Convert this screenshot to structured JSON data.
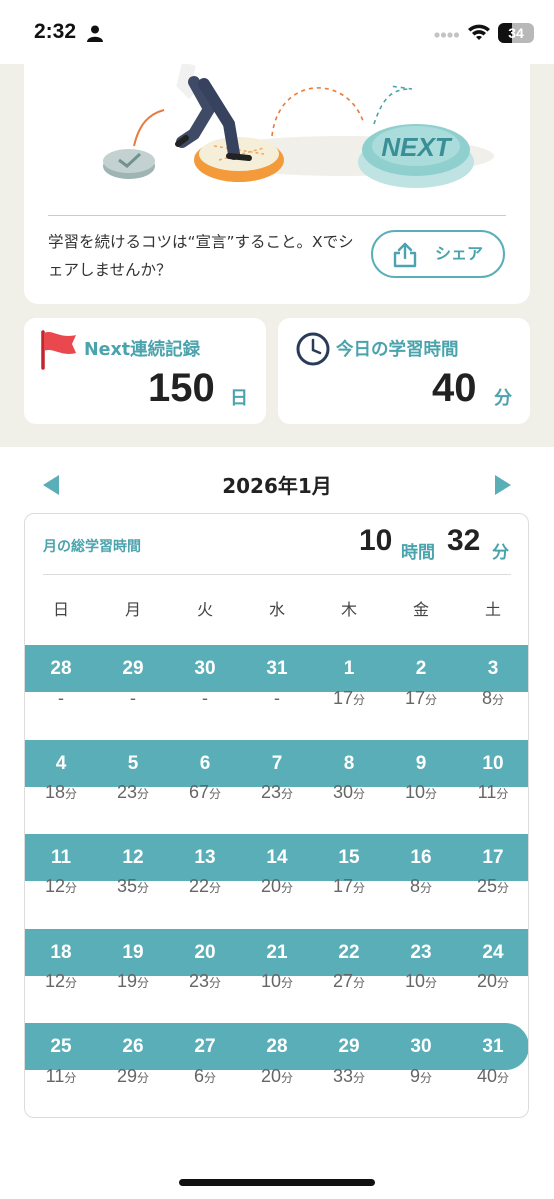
{
  "status_bar": {
    "time": "2:32",
    "battery": "34"
  },
  "share": {
    "text": "学習を続けるコツは“宣言”すること。Xでシェアしませんか？",
    "button_label": "シェア",
    "illustration_label": "NEXT"
  },
  "streak": {
    "title": "Next連続記録",
    "value": "150",
    "unit": "日"
  },
  "today": {
    "title": "今日の学習時間",
    "value": "40",
    "unit": "分"
  },
  "calendar": {
    "month_title": "2026年1月",
    "total_label": "月の総学習時間",
    "total_hours": "10",
    "hours_unit": "時間",
    "total_minutes": "32",
    "minutes_unit": "分",
    "weekdays": [
      "日",
      "月",
      "火",
      "水",
      "木",
      "金",
      "土"
    ],
    "weeks": [
      {
        "days": [
          "28",
          "29",
          "30",
          "31",
          "1",
          "2",
          "3"
        ],
        "minutes": [
          "-",
          "-",
          "-",
          "-",
          "17",
          "17",
          "8"
        ]
      },
      {
        "days": [
          "4",
          "5",
          "6",
          "7",
          "8",
          "9",
          "10"
        ],
        "minutes": [
          "18",
          "23",
          "67",
          "23",
          "30",
          "10",
          "11"
        ]
      },
      {
        "days": [
          "11",
          "12",
          "13",
          "14",
          "15",
          "16",
          "17"
        ],
        "minutes": [
          "12",
          "35",
          "22",
          "20",
          "17",
          "8",
          "25"
        ]
      },
      {
        "days": [
          "18",
          "19",
          "20",
          "21",
          "22",
          "23",
          "24"
        ],
        "minutes": [
          "12",
          "19",
          "23",
          "10",
          "27",
          "10",
          "20"
        ]
      },
      {
        "days": [
          "25",
          "26",
          "27",
          "28",
          "29",
          "30",
          "31"
        ],
        "minutes": [
          "11",
          "29",
          "6",
          "20",
          "33",
          "9",
          "40"
        ]
      }
    ],
    "minute_unit": "分"
  },
  "colors": {
    "accent": "#5aaeb8",
    "accent_text": "#4aa3ad",
    "background": "#f1f0e8"
  }
}
